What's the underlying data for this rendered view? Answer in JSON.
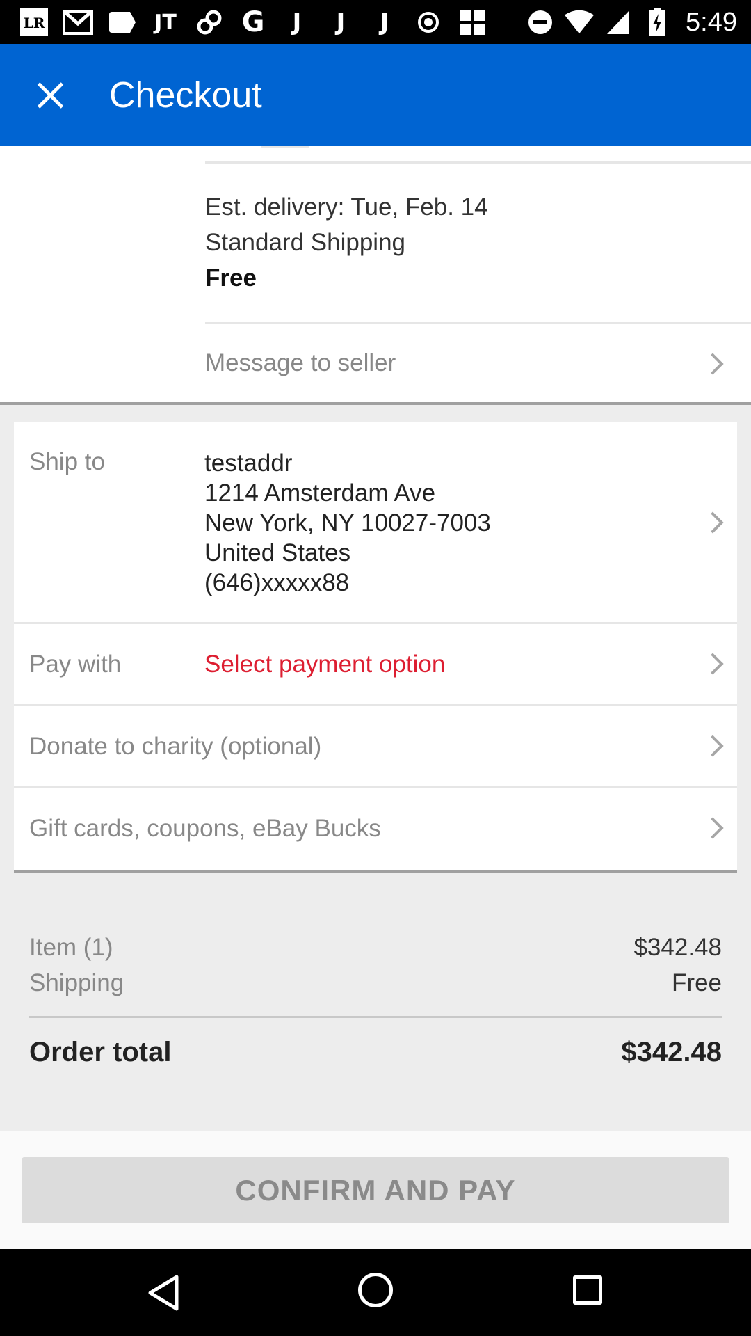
{
  "status_bar": {
    "time": "5:49",
    "left_icons": [
      "lr-icon",
      "gmail-icon",
      "tag-icon",
      "jt-icon",
      "link-icon",
      "google-icon",
      "j-icon",
      "j-icon",
      "j-icon",
      "record-icon",
      "grid-icon"
    ],
    "right_icons": [
      "dnd-icon",
      "wifi-icon",
      "signal-icon",
      "battery-charging-icon"
    ]
  },
  "app_bar": {
    "title": "Checkout"
  },
  "shipping_option": {
    "delivery": "Est. delivery: Tue, Feb. 14",
    "method": "Standard Shipping",
    "price": "Free"
  },
  "message_row": {
    "label": "Message to seller"
  },
  "ship_to": {
    "label": "Ship to",
    "name": "testaddr",
    "street": "1214 Amsterdam Ave",
    "city": "New York, NY 10027-7003",
    "country": "United States",
    "phone": "(646)xxxxx88"
  },
  "pay_with": {
    "label": "Pay with",
    "value": "Select payment option"
  },
  "donate": {
    "label": "Donate to charity (optional)"
  },
  "gift_cards": {
    "label": "Gift cards, coupons, eBay Bucks"
  },
  "summary": {
    "item_label": "Item (1)",
    "item_value": "$342.48",
    "shipping_label": "Shipping",
    "shipping_value": "Free",
    "total_label": "Order total",
    "total_value": "$342.48"
  },
  "action": {
    "confirm_label": "CONFIRM AND PAY"
  },
  "colors": {
    "app_bar": "#0064d2",
    "payment_warning": "#dd1e31",
    "disabled_button": "#dcdcdc"
  }
}
